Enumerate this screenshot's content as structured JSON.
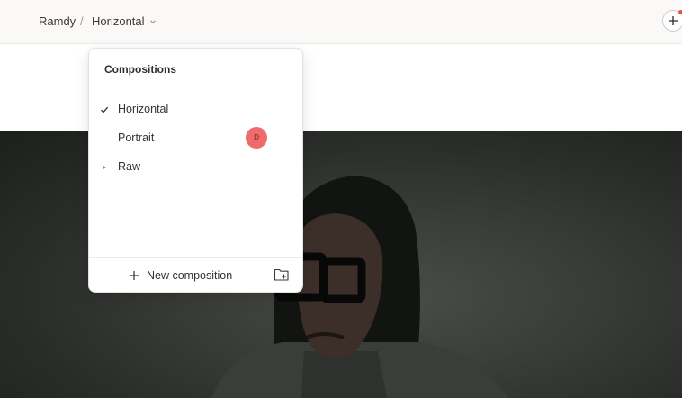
{
  "breadcrumb": {
    "root": "Ramdy",
    "separator": "/",
    "current": "Horizontal"
  },
  "dropdown": {
    "title": "Compositions",
    "items": [
      {
        "label": "Horizontal",
        "selected": true
      },
      {
        "label": "Portrait",
        "badge": "D"
      },
      {
        "label": "Raw",
        "expandable": true
      }
    ],
    "footer": {
      "new_label": "New composition"
    }
  },
  "colors": {
    "badge": "#ef6a6a",
    "notify_dot": "#e9534d"
  },
  "icons": {
    "chevron": "chevron-down-icon",
    "add": "plus-icon",
    "check": "check-icon",
    "expand": "triangle-right-icon",
    "folder": "folder-add-icon"
  }
}
